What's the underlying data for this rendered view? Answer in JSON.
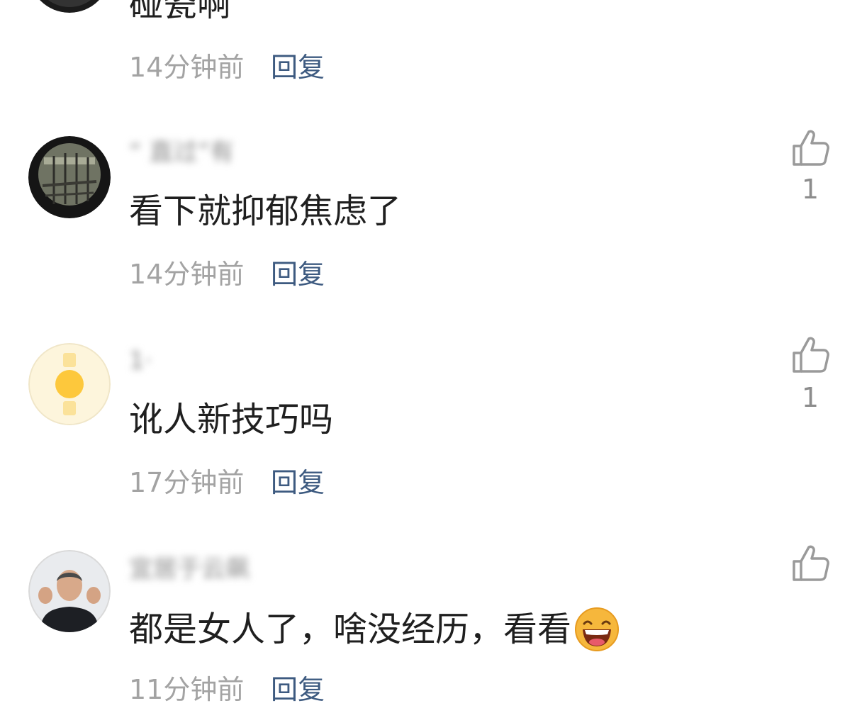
{
  "comments": [
    {
      "username": "",
      "text": "碰瓷啊",
      "time": "14分钟前",
      "reply": "回复",
      "likes": ""
    },
    {
      "username": "“ 直过”有 ",
      "text": "看下就抑郁焦虑了",
      "time": "14分钟前",
      "reply": "回复",
      "likes": "1"
    },
    {
      "username": "1·",
      "text": "讹人新技巧吗",
      "time": "17分钟前",
      "reply": "回复",
      "likes": "1"
    },
    {
      "username": "宜居于云飙",
      "text": "都是女人了，啥没经历，看看",
      "time": "11分钟前",
      "reply": "回复",
      "likes": "",
      "emoji": "laughing-emoji"
    }
  ],
  "colors": {
    "reply": "#3d5a80",
    "time": "#a3a3a3",
    "text": "#1f1f1f",
    "icon": "#9a9a9a"
  }
}
